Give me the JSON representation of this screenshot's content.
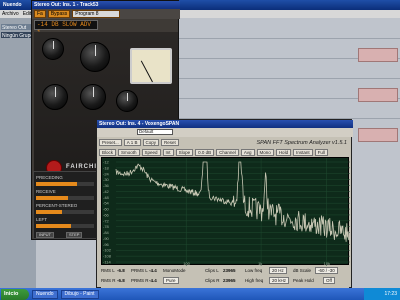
{
  "nuendo": {
    "title": "Nuendo",
    "menu": [
      "Archivo",
      "Edit"
    ],
    "tracks": [
      "Stereo Out",
      "Ningún Grupo"
    ]
  },
  "plugin_window": {
    "title": "Stereo Out: Ins. 1 - Track53",
    "toolbar": [
      "Fa",
      "Bypass",
      "Program 8"
    ],
    "preset": "-14 DB SLOW ADV 1",
    "brand": "FAIRCHILD",
    "channel_panel": {
      "rows": [
        "PRECEDING",
        "RECEIVE",
        "PERCENT-STEREO",
        "LEFT"
      ],
      "fills": [
        0.7,
        0.55,
        0.45,
        0.6
      ]
    },
    "bottom_buttons": [
      "INPUT",
      "STEP"
    ]
  },
  "span_window": {
    "title": "Stereo Out: Ins. 4 - VoxengoSPAN",
    "preset_dropdown": "Default",
    "header_buttons": [
      "Preset...",
      "A 1 B",
      "Copy",
      "Reset"
    ],
    "app_name": "SPAN FFT Spectrum Analyzer v1.5.1",
    "ctrl_row2": [
      "Block",
      "Smooth",
      "Speed",
      "Int",
      "Slope",
      "0.0 dB",
      "Channel",
      "Avg",
      "Mono",
      "Hold",
      "Instant",
      "Full"
    ],
    "freq_ticks": [
      "100",
      "1k",
      "10k"
    ],
    "footer": {
      "rms_l_label": "RMS L",
      "rms_l_value": "-6.8",
      "prms_l_label": "PRMS L",
      "prms_l_value": "-4.4",
      "mono_label": "MonoMode",
      "clips_l_label": "Clips L",
      "clips_l_value": "23965",
      "low_freq_label": "Low freq",
      "low_freq_value": "20 Hz",
      "db_scale_label": "dB Scale",
      "rms_r_label": "RMS R",
      "rms_r_value": "-6.8",
      "prms_r_label": "PRMS R",
      "prms_r_value": "-4.4",
      "pure_label": "Pure",
      "clips_r_label": "Clips R",
      "clips_r_value": "23965",
      "high_freq_label": "High freq",
      "high_freq_value": "20 kHz",
      "peak_hold_label": "Peak Hold",
      "off_label": "Off",
      "scale_value": "-60 / -30"
    }
  },
  "taskbar": {
    "start": "Inicio",
    "tasks": [
      "Nuendo",
      "Dibujo - Paint"
    ],
    "clock": "17:23"
  },
  "colors": {
    "analyzer_bg": "#0e2a1a",
    "spectrum": "#c8c8b4",
    "accent": "#e58a1c"
  },
  "spectrum_scale_left": [
    "-12",
    "-18",
    "-24",
    "-30",
    "-36",
    "-42",
    "-48",
    "-54",
    "-60",
    "-66",
    "-72",
    "-78",
    "-84",
    "-90",
    "-96",
    "-102",
    "-108",
    "-114"
  ]
}
